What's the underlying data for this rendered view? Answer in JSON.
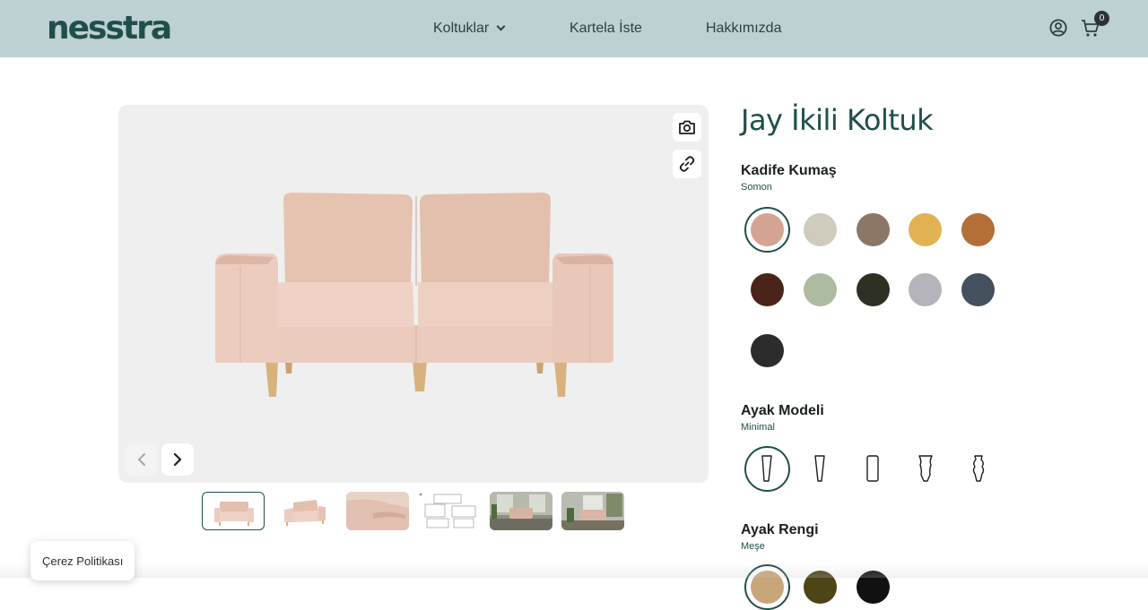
{
  "header": {
    "logo": "nesstra",
    "nav": [
      {
        "label": "Koltuklar"
      },
      {
        "label": "Kartela İste"
      },
      {
        "label": "Hakkımızda"
      }
    ],
    "cart_count": "0"
  },
  "product": {
    "title": "Jay İkili Koltuk",
    "fabric": {
      "label": "Kadife Kumaş",
      "selected": "Somon",
      "swatches": [
        "#d4a492",
        "#cfcbbd",
        "#8c7766",
        "#e0b252",
        "#b26f36",
        "#4a2418",
        "#adbba3",
        "#2f3024",
        "#b5b4bb",
        "#45505e",
        "#2c2c2c"
      ]
    },
    "leg_model": {
      "label": "Ayak Modeli",
      "selected": "Minimal",
      "icons": [
        "leg-minimal-icon",
        "leg-tapered-icon",
        "leg-block-icon",
        "leg-curved-icon",
        "leg-turned-icon"
      ]
    },
    "leg_color": {
      "label": "Ayak Rengi",
      "selected": "Meşe",
      "swatches": [
        "#c9a57a",
        "#4d4418",
        "#111111"
      ]
    }
  },
  "gallery": {
    "icons": [
      "camera-icon",
      "link-icon",
      "chevron-left-icon",
      "chevron-right-icon"
    ],
    "thumbnail_count": 6
  },
  "cookie": {
    "label": "Çerez Politikası"
  },
  "colors": {
    "brand": "#1f4f4b",
    "header_bg": "#bdd0d2",
    "sofa": "#e8c6b8"
  }
}
